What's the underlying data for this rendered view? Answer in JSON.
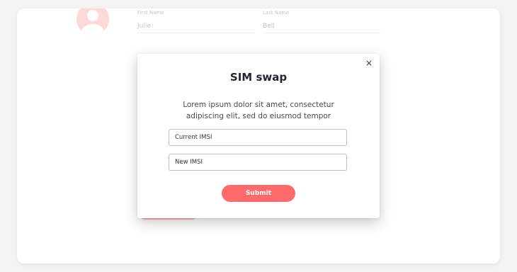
{
  "profile": {
    "first_name_label": "First Name",
    "first_name_value": "Julie",
    "last_name_label": "Last Name",
    "last_name_value": "Bell",
    "avatar_icon": "user-avatar-icon"
  },
  "modal": {
    "title": "SIM swap",
    "close_icon": "close-icon",
    "close_label": "×",
    "description": "Lorem ipsum dolor sit amet, consectetur adipiscing elit, sed do eiusmod tempor",
    "current_imsi_placeholder": "Current IMSI",
    "new_imsi_placeholder": "New IMSI",
    "submit_label": "Submit"
  },
  "colors": {
    "accent": "#ff6b6b",
    "accent_light": "#ffd8d8",
    "title": "#2a2133"
  }
}
